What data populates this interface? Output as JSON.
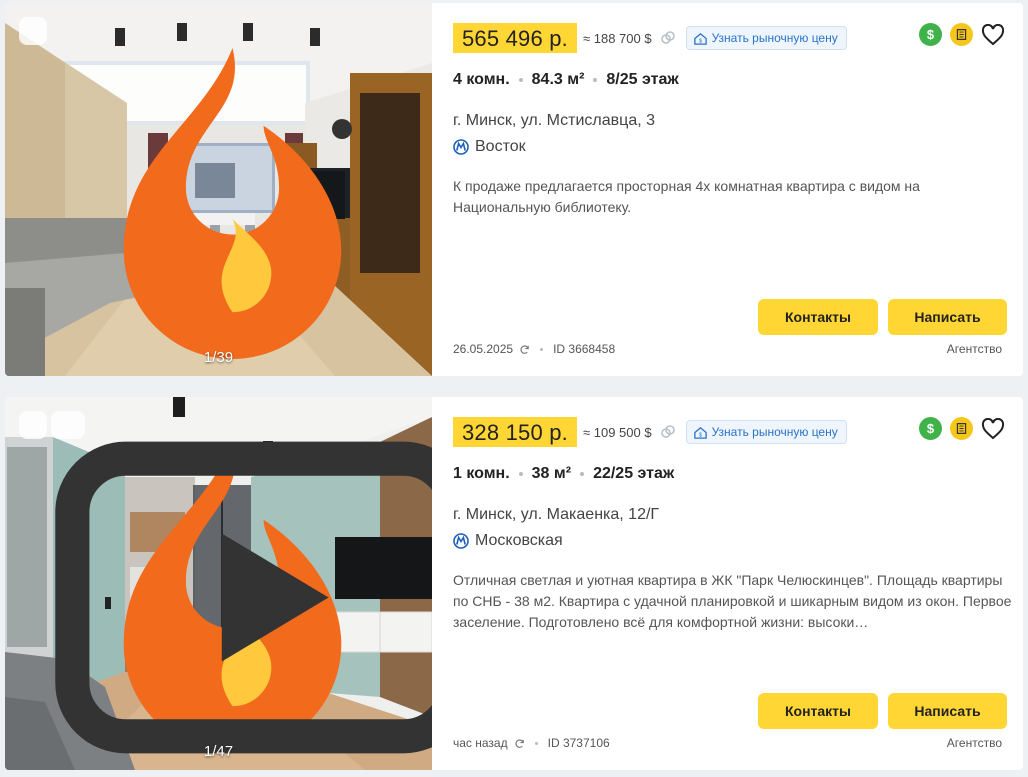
{
  "listings": [
    {
      "price": "565 496 р.",
      "usd": "≈ 188 700 $",
      "market_btn": "Узнать рыночную цену",
      "rooms": "4 комн.",
      "area": "84.3 м²",
      "floor": "8/25 этаж",
      "address": "г. Минск, ул. Мстиславца, 3",
      "metro": "Восток",
      "description": "К продаже предлагается просторная 4х комнатная квартира с видом на Национальную библиотеку.",
      "contacts_label": "Контакты",
      "write_label": "Написать",
      "date": "26.05.2025",
      "id": "ID 3668458",
      "seller": "Агентство",
      "photo_counter": "1/39",
      "badges": [
        "fire-icon"
      ]
    },
    {
      "price": "328 150 р.",
      "usd": "≈ 109 500 $",
      "market_btn": "Узнать рыночную цену",
      "rooms": "1 комн.",
      "area": "38 м²",
      "floor": "22/25 этаж",
      "address": "г. Минск, ул. Макаенка, 12/Г",
      "metro": "Московская",
      "description": "Отличная светлая и уютная квартира в ЖК \"Парк Челюскинцев\". Площадь квартиры по СНБ - 38 м2. Квартира с удачной планировкой и шикарным видом из окон. Первое заселение. Подготовлено всё для комфортной жизни: высоки…",
      "contacts_label": "Контакты",
      "write_label": "Написать",
      "date": "час назад",
      "id": "ID 3737106",
      "seller": "Агентство",
      "photo_counter": "1/47",
      "badges": [
        "fire-icon",
        "video-icon"
      ]
    }
  ],
  "colors": {
    "price_highlight": "#ffd633",
    "button_yellow": "#ffd633",
    "link_blue": "#2a73c8",
    "dollar_green": "#3fb24a",
    "page_bg": "#eef1f4"
  }
}
